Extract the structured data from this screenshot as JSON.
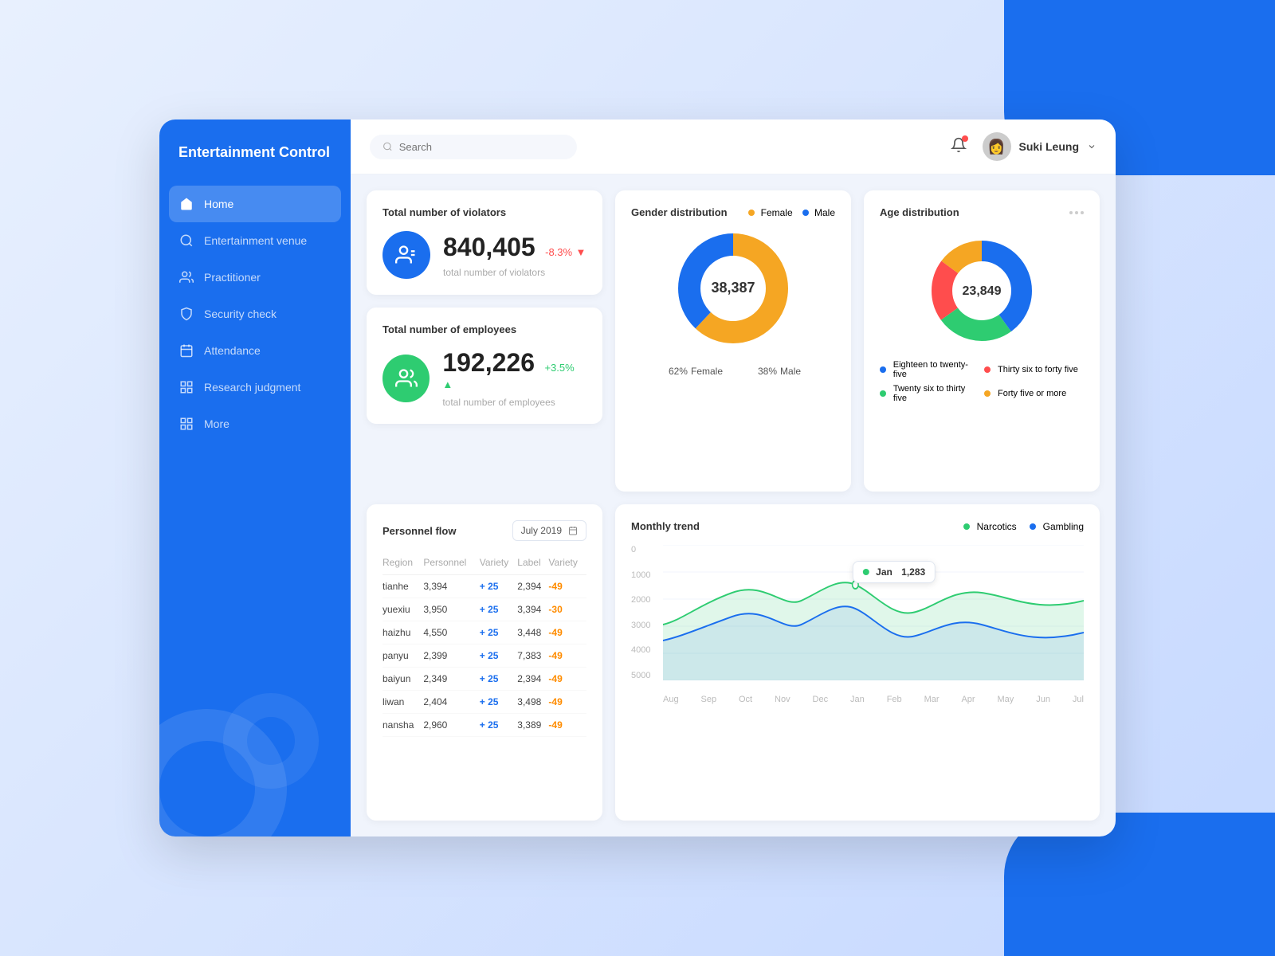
{
  "app": {
    "title": "Entertainment Control"
  },
  "header": {
    "search_placeholder": "Search",
    "user_name": "Suki Leung"
  },
  "sidebar": {
    "items": [
      {
        "id": "home",
        "label": "Home",
        "active": true
      },
      {
        "id": "entertainment-venue",
        "label": "Entertainment venue",
        "active": false
      },
      {
        "id": "practitioner",
        "label": "Practitioner",
        "active": false
      },
      {
        "id": "security-check",
        "label": "Security check",
        "active": false
      },
      {
        "id": "attendance",
        "label": "Attendance",
        "active": false
      },
      {
        "id": "research-judgment",
        "label": "Research judgment",
        "active": false
      },
      {
        "id": "more",
        "label": "More",
        "active": false
      }
    ]
  },
  "violators": {
    "title": "Total number of violators",
    "count": "840,405",
    "change": "-8.3%",
    "label": "total number of violators"
  },
  "employees": {
    "title": "Total number of employees",
    "count": "192,226",
    "change": "+3.5%",
    "label": "total number of employees"
  },
  "gender": {
    "title": "Gender distribution",
    "center_value": "38,387",
    "female_pct": "62%",
    "male_pct": "38%",
    "female_label": "Female",
    "male_label": "Male"
  },
  "age": {
    "title": "Age distribution",
    "center_value": "23,849",
    "legend": [
      {
        "label": "Eighteen to twenty-five",
        "color": "#1a6eee"
      },
      {
        "label": "Thirty six to forty five",
        "color": "#ff4d4d"
      },
      {
        "label": "Twenty six to thirty five",
        "color": "#2ecc71"
      },
      {
        "label": "Forty five or more",
        "color": "#f5a623"
      }
    ]
  },
  "flow": {
    "title": "Personnel flow",
    "date": "July 2019",
    "columns": [
      "Region",
      "Personnel",
      "Variety",
      "Label",
      "Variety"
    ],
    "rows": [
      {
        "region": "tianhe",
        "personnel": "3,394",
        "variety1": "+ 25",
        "label": "2,394",
        "variety2": "-49"
      },
      {
        "region": "yuexiu",
        "personnel": "3,950",
        "variety1": "+ 25",
        "label": "3,394",
        "variety2": "-30"
      },
      {
        "region": "haizhu",
        "personnel": "4,550",
        "variety1": "+ 25",
        "label": "3,448",
        "variety2": "-49"
      },
      {
        "region": "panyu",
        "personnel": "2,399",
        "variety1": "+ 25",
        "label": "7,383",
        "variety2": "-49"
      },
      {
        "region": "baiyun",
        "personnel": "2,349",
        "variety1": "+ 25",
        "label": "2,394",
        "variety2": "-49"
      },
      {
        "region": "liwan",
        "personnel": "2,404",
        "variety1": "+ 25",
        "label": "3,498",
        "variety2": "-49"
      },
      {
        "region": "nansha",
        "personnel": "2,960",
        "variety1": "+ 25",
        "label": "3,389",
        "variety2": "-49"
      }
    ]
  },
  "trend": {
    "title": "Monthly trend",
    "legend": [
      {
        "label": "Narcotics",
        "color": "#2ecc71"
      },
      {
        "label": "Gambling",
        "color": "#1a6eee"
      }
    ],
    "tooltip": {
      "label": "Jan",
      "value": "1,283"
    },
    "y_labels": [
      "0",
      "1000",
      "2000",
      "3000",
      "4000",
      "5000"
    ],
    "x_labels": [
      "Aug",
      "Sep",
      "Oct",
      "Nov",
      "Dec",
      "Jan",
      "Feb",
      "Mar",
      "Apr",
      "May",
      "Jun",
      "Jul"
    ]
  }
}
